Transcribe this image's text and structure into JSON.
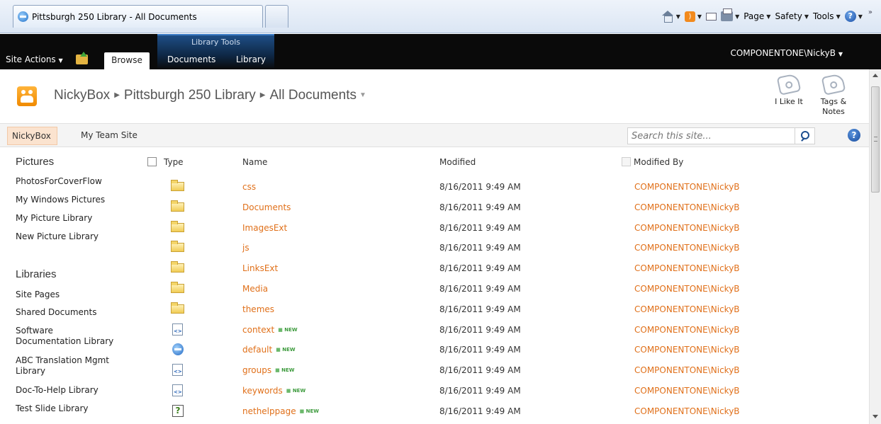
{
  "browser": {
    "tab_title": "Pittsburgh 250 Library - All Documents",
    "command_bar": {
      "page": "Page",
      "safety": "Safety",
      "tools": "Tools",
      "more": "»"
    }
  },
  "ribbon": {
    "site_actions": "Site Actions",
    "browse": "Browse",
    "library_tools": "Library Tools",
    "documents": "Documents",
    "library": "Library",
    "user": "COMPONENTONE\\NickyB"
  },
  "title_area": {
    "breadcrumb": [
      "NickyBox",
      "Pittsburgh 250 Library",
      "All Documents"
    ],
    "like_it": "I Like It",
    "tags_notes_line1": "Tags &",
    "tags_notes_line2": "Notes"
  },
  "topnav": {
    "items": [
      "NickyBox",
      "My Team Site"
    ],
    "search_placeholder": "Search this site...",
    "help": "?"
  },
  "quicklaunch": {
    "pictures_heading": "Pictures",
    "pictures": [
      "PhotosForCoverFlow",
      "My Windows Pictures",
      "My Picture Library",
      "New Picture Library"
    ],
    "libraries_heading": "Libraries",
    "libraries": [
      [
        "Site Pages"
      ],
      [
        "Shared Documents"
      ],
      [
        "Software",
        "Documentation Library"
      ],
      [
        "ABC Translation Mgmt",
        "Library"
      ],
      [
        "Doc-To-Help Library"
      ],
      [
        "Test Slide Library"
      ]
    ]
  },
  "list": {
    "columns": {
      "type": "Type",
      "name": "Name",
      "modified": "Modified",
      "modified_by": "Modified By"
    },
    "new_label": "NEW",
    "rows": [
      {
        "icon": "folder-icon",
        "name": "css",
        "modified": "8/16/2011 9:49 AM",
        "modified_by": "COMPONENTONE\\NickyB",
        "is_new": false
      },
      {
        "icon": "folder-icon",
        "name": "Documents",
        "modified": "8/16/2011 9:49 AM",
        "modified_by": "COMPONENTONE\\NickyB",
        "is_new": false
      },
      {
        "icon": "folder-icon",
        "name": "ImagesExt",
        "modified": "8/16/2011 9:49 AM",
        "modified_by": "COMPONENTONE\\NickyB",
        "is_new": false
      },
      {
        "icon": "folder-icon",
        "name": "js",
        "modified": "8/16/2011 9:49 AM",
        "modified_by": "COMPONENTONE\\NickyB",
        "is_new": false
      },
      {
        "icon": "folder-icon",
        "name": "LinksExt",
        "modified": "8/16/2011 9:49 AM",
        "modified_by": "COMPONENTONE\\NickyB",
        "is_new": false
      },
      {
        "icon": "folder-icon",
        "name": "Media",
        "modified": "8/16/2011 9:49 AM",
        "modified_by": "COMPONENTONE\\NickyB",
        "is_new": false
      },
      {
        "icon": "folder-icon",
        "name": "themes",
        "modified": "8/16/2011 9:49 AM",
        "modified_by": "COMPONENTONE\\NickyB",
        "is_new": false
      },
      {
        "icon": "xml-file-icon",
        "name": "context",
        "modified": "8/16/2011 9:49 AM",
        "modified_by": "COMPONENTONE\\NickyB",
        "is_new": true
      },
      {
        "icon": "html-file-icon",
        "name": "default",
        "modified": "8/16/2011 9:49 AM",
        "modified_by": "COMPONENTONE\\NickyB",
        "is_new": true
      },
      {
        "icon": "xml-file-icon",
        "name": "groups",
        "modified": "8/16/2011 9:49 AM",
        "modified_by": "COMPONENTONE\\NickyB",
        "is_new": true
      },
      {
        "icon": "xml-file-icon",
        "name": "keywords",
        "modified": "8/16/2011 9:49 AM",
        "modified_by": "COMPONENTONE\\NickyB",
        "is_new": true
      },
      {
        "icon": "help-file-icon",
        "name": "nethelppage",
        "modified": "8/16/2011 9:49 AM",
        "modified_by": "COMPONENTONE\\NickyB",
        "is_new": true
      }
    ]
  }
}
